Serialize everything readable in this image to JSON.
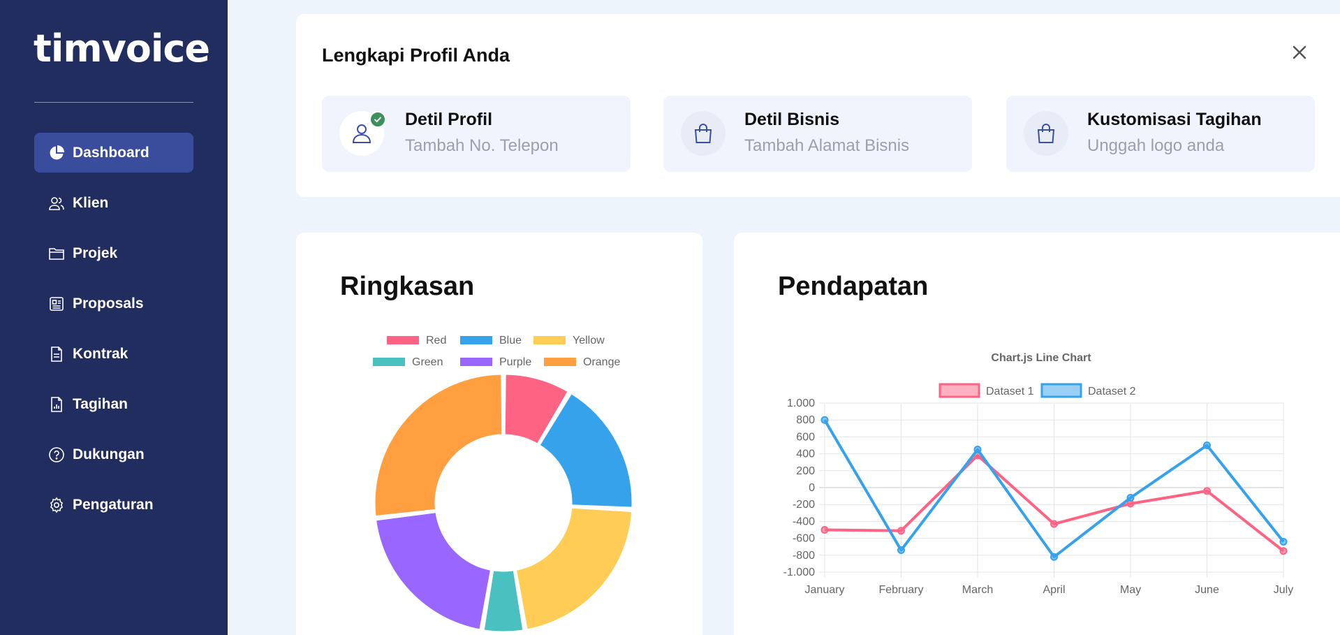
{
  "sidebar": {
    "logo": "timvoice",
    "items": [
      {
        "label": "Dashboard",
        "icon": "pie-chart-icon",
        "active": true
      },
      {
        "label": "Klien",
        "icon": "users-icon",
        "active": false
      },
      {
        "label": "Projek",
        "icon": "folder-icon",
        "active": false
      },
      {
        "label": "Proposals",
        "icon": "proposal-icon",
        "active": false
      },
      {
        "label": "Kontrak",
        "icon": "document-icon",
        "active": false
      },
      {
        "label": "Tagihan",
        "icon": "invoice-icon",
        "active": false
      },
      {
        "label": "Dukungan",
        "icon": "help-icon",
        "active": false
      },
      {
        "label": "Pengaturan",
        "icon": "gear-icon",
        "active": false
      }
    ]
  },
  "profile": {
    "title": "Lengkapi Profil Anda",
    "close_icon": "close-icon",
    "steps": [
      {
        "title": "Detil Profil",
        "subtitle": "Tambah No. Telepon",
        "icon": "user-icon",
        "completed": true
      },
      {
        "title": "Detil Bisnis",
        "subtitle": "Tambah Alamat Bisnis",
        "icon": "shopping-bag-icon",
        "completed": false
      },
      {
        "title": "Kustomisasi Tagihan",
        "subtitle": "Unggah logo anda",
        "icon": "shopping-bag-icon",
        "completed": false
      }
    ]
  },
  "summary": {
    "title": "Ringkasan"
  },
  "revenue": {
    "title": "Pendapatan"
  },
  "colors": {
    "sidebar_bg": "#212d5e",
    "active_nav": "#3a4d9c",
    "accent": "#3b4fa8",
    "check": "#3d8f5e"
  },
  "chart_data": [
    {
      "type": "pie",
      "variant": "doughnut",
      "labels": [
        "Red",
        "Blue",
        "Yellow",
        "Green",
        "Purple",
        "Orange"
      ],
      "values": [
        8,
        16,
        20,
        5,
        19,
        25
      ],
      "colors": [
        "#ff6384",
        "#36a2eb",
        "#ffcd56",
        "#4bc0c0",
        "#9966ff",
        "#ff9f40"
      ],
      "legend": "top",
      "visible_portion": "top"
    },
    {
      "type": "line",
      "title": "Chart.js Line Chart",
      "categories": [
        "January",
        "February",
        "March",
        "April",
        "May",
        "June",
        "July"
      ],
      "series": [
        {
          "name": "Dataset 1",
          "values": [
            -500,
            -510,
            380,
            -430,
            -190,
            -40,
            -750
          ],
          "color": "#ff6384"
        },
        {
          "name": "Dataset 2",
          "values": [
            800,
            -740,
            450,
            -820,
            -120,
            500,
            -640
          ],
          "color": "#36a2eb"
        }
      ],
      "ylim": [
        -1000,
        1000
      ],
      "yticks": [
        "1.000",
        "800",
        "600",
        "400",
        "200",
        "0",
        "-200",
        "-400",
        "-600",
        "-800",
        "-1.000"
      ],
      "grid": true,
      "legend": "top"
    }
  ]
}
